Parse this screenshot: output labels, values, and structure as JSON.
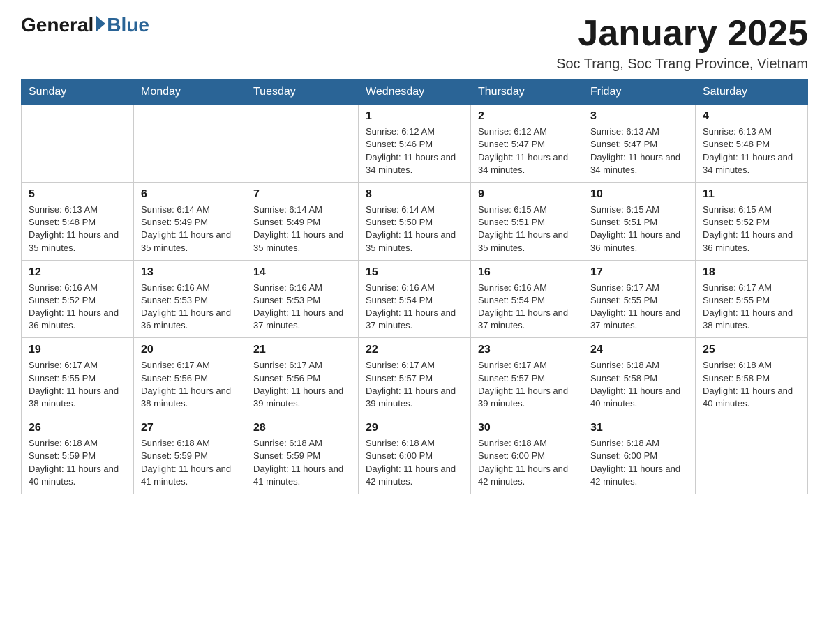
{
  "logo": {
    "general": "General",
    "blue": "Blue"
  },
  "title": {
    "month_year": "January 2025",
    "location": "Soc Trang, Soc Trang Province, Vietnam"
  },
  "weekdays": [
    "Sunday",
    "Monday",
    "Tuesday",
    "Wednesday",
    "Thursday",
    "Friday",
    "Saturday"
  ],
  "weeks": [
    [
      {
        "day": "",
        "info": ""
      },
      {
        "day": "",
        "info": ""
      },
      {
        "day": "",
        "info": ""
      },
      {
        "day": "1",
        "info": "Sunrise: 6:12 AM\nSunset: 5:46 PM\nDaylight: 11 hours and 34 minutes."
      },
      {
        "day": "2",
        "info": "Sunrise: 6:12 AM\nSunset: 5:47 PM\nDaylight: 11 hours and 34 minutes."
      },
      {
        "day": "3",
        "info": "Sunrise: 6:13 AM\nSunset: 5:47 PM\nDaylight: 11 hours and 34 minutes."
      },
      {
        "day": "4",
        "info": "Sunrise: 6:13 AM\nSunset: 5:48 PM\nDaylight: 11 hours and 34 minutes."
      }
    ],
    [
      {
        "day": "5",
        "info": "Sunrise: 6:13 AM\nSunset: 5:48 PM\nDaylight: 11 hours and 35 minutes."
      },
      {
        "day": "6",
        "info": "Sunrise: 6:14 AM\nSunset: 5:49 PM\nDaylight: 11 hours and 35 minutes."
      },
      {
        "day": "7",
        "info": "Sunrise: 6:14 AM\nSunset: 5:49 PM\nDaylight: 11 hours and 35 minutes."
      },
      {
        "day": "8",
        "info": "Sunrise: 6:14 AM\nSunset: 5:50 PM\nDaylight: 11 hours and 35 minutes."
      },
      {
        "day": "9",
        "info": "Sunrise: 6:15 AM\nSunset: 5:51 PM\nDaylight: 11 hours and 35 minutes."
      },
      {
        "day": "10",
        "info": "Sunrise: 6:15 AM\nSunset: 5:51 PM\nDaylight: 11 hours and 36 minutes."
      },
      {
        "day": "11",
        "info": "Sunrise: 6:15 AM\nSunset: 5:52 PM\nDaylight: 11 hours and 36 minutes."
      }
    ],
    [
      {
        "day": "12",
        "info": "Sunrise: 6:16 AM\nSunset: 5:52 PM\nDaylight: 11 hours and 36 minutes."
      },
      {
        "day": "13",
        "info": "Sunrise: 6:16 AM\nSunset: 5:53 PM\nDaylight: 11 hours and 36 minutes."
      },
      {
        "day": "14",
        "info": "Sunrise: 6:16 AM\nSunset: 5:53 PM\nDaylight: 11 hours and 37 minutes."
      },
      {
        "day": "15",
        "info": "Sunrise: 6:16 AM\nSunset: 5:54 PM\nDaylight: 11 hours and 37 minutes."
      },
      {
        "day": "16",
        "info": "Sunrise: 6:16 AM\nSunset: 5:54 PM\nDaylight: 11 hours and 37 minutes."
      },
      {
        "day": "17",
        "info": "Sunrise: 6:17 AM\nSunset: 5:55 PM\nDaylight: 11 hours and 37 minutes."
      },
      {
        "day": "18",
        "info": "Sunrise: 6:17 AM\nSunset: 5:55 PM\nDaylight: 11 hours and 38 minutes."
      }
    ],
    [
      {
        "day": "19",
        "info": "Sunrise: 6:17 AM\nSunset: 5:55 PM\nDaylight: 11 hours and 38 minutes."
      },
      {
        "day": "20",
        "info": "Sunrise: 6:17 AM\nSunset: 5:56 PM\nDaylight: 11 hours and 38 minutes."
      },
      {
        "day": "21",
        "info": "Sunrise: 6:17 AM\nSunset: 5:56 PM\nDaylight: 11 hours and 39 minutes."
      },
      {
        "day": "22",
        "info": "Sunrise: 6:17 AM\nSunset: 5:57 PM\nDaylight: 11 hours and 39 minutes."
      },
      {
        "day": "23",
        "info": "Sunrise: 6:17 AM\nSunset: 5:57 PM\nDaylight: 11 hours and 39 minutes."
      },
      {
        "day": "24",
        "info": "Sunrise: 6:18 AM\nSunset: 5:58 PM\nDaylight: 11 hours and 40 minutes."
      },
      {
        "day": "25",
        "info": "Sunrise: 6:18 AM\nSunset: 5:58 PM\nDaylight: 11 hours and 40 minutes."
      }
    ],
    [
      {
        "day": "26",
        "info": "Sunrise: 6:18 AM\nSunset: 5:59 PM\nDaylight: 11 hours and 40 minutes."
      },
      {
        "day": "27",
        "info": "Sunrise: 6:18 AM\nSunset: 5:59 PM\nDaylight: 11 hours and 41 minutes."
      },
      {
        "day": "28",
        "info": "Sunrise: 6:18 AM\nSunset: 5:59 PM\nDaylight: 11 hours and 41 minutes."
      },
      {
        "day": "29",
        "info": "Sunrise: 6:18 AM\nSunset: 6:00 PM\nDaylight: 11 hours and 42 minutes."
      },
      {
        "day": "30",
        "info": "Sunrise: 6:18 AM\nSunset: 6:00 PM\nDaylight: 11 hours and 42 minutes."
      },
      {
        "day": "31",
        "info": "Sunrise: 6:18 AM\nSunset: 6:00 PM\nDaylight: 11 hours and 42 minutes."
      },
      {
        "day": "",
        "info": ""
      }
    ]
  ]
}
